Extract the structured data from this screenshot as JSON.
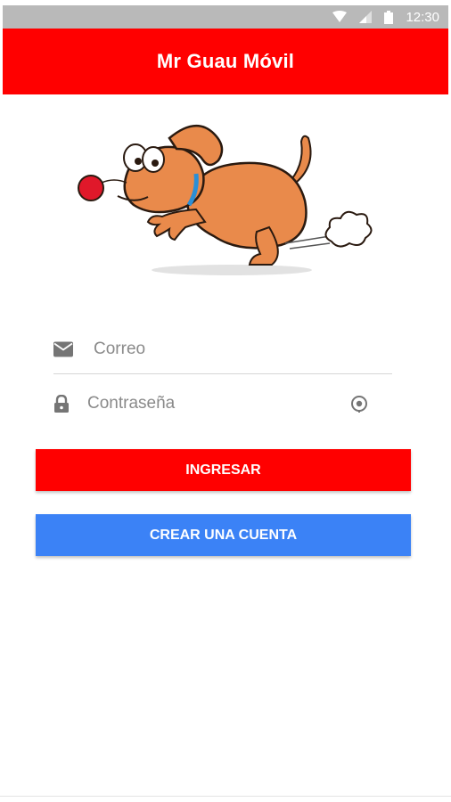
{
  "status_bar": {
    "time": "12:30",
    "icons": [
      "wifi-icon",
      "signal-icon",
      "battery-icon"
    ]
  },
  "app_bar": {
    "title": "Mr Guau Móvil",
    "color": "#ff0000"
  },
  "illustration": {
    "name": "dog-mascot"
  },
  "login_form": {
    "email": {
      "placeholder": "Correo",
      "value": "",
      "icon": "mail-icon"
    },
    "password": {
      "placeholder": "Contraseña",
      "value": "",
      "icon": "lock-icon",
      "toggle_icon": "eye-toggle-icon"
    }
  },
  "buttons": {
    "login_label": "INGRESAR",
    "login_color": "#ff0000",
    "register_label": "CREAR UNA CUENTA",
    "register_color": "#3b82f6"
  }
}
